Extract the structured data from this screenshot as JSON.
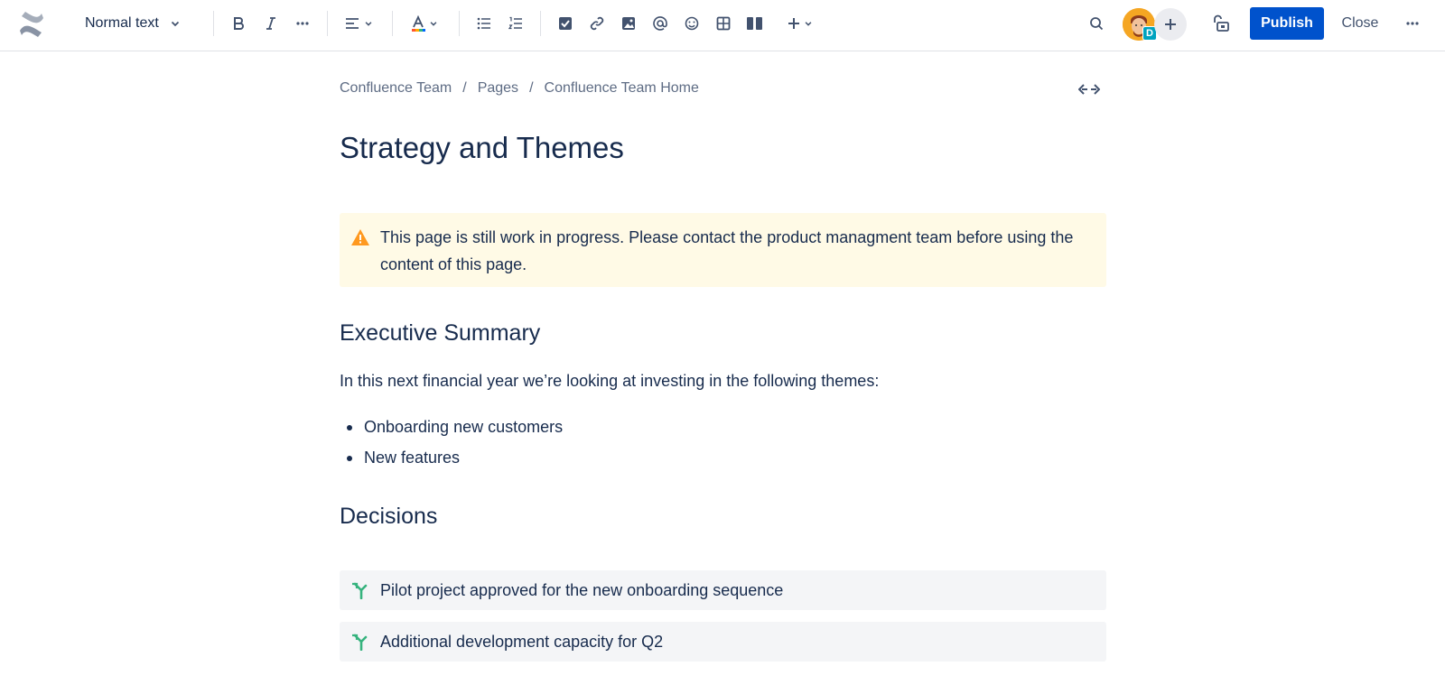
{
  "toolbar": {
    "text_style": "Normal text",
    "publish_label": "Publish",
    "close_label": "Close",
    "avatar_badge": "D"
  },
  "breadcrumb": {
    "items": [
      "Confluence Team",
      "Pages",
      "Confluence Team Home"
    ],
    "separator": "/"
  },
  "page": {
    "title": "Strategy and Themes",
    "warning": "This page is still work in progress. Please contact the product managment team before using the content of this page.",
    "sections": [
      {
        "heading": "Executive Summary",
        "intro": "In this next financial year we’re looking at investing in the following themes:",
        "bullets": [
          "Onboarding new customers",
          "New features"
        ]
      },
      {
        "heading": "Decisions",
        "decisions": [
          "Pilot project approved for the new onboarding sequence",
          "Additional development capacity for Q2"
        ]
      }
    ]
  },
  "colors": {
    "primary": "#0052CC",
    "warning_bg": "#FFFAE6",
    "warning_icon": "#FF991F",
    "decision_icon": "#36B37E",
    "text": "#172B4D"
  }
}
